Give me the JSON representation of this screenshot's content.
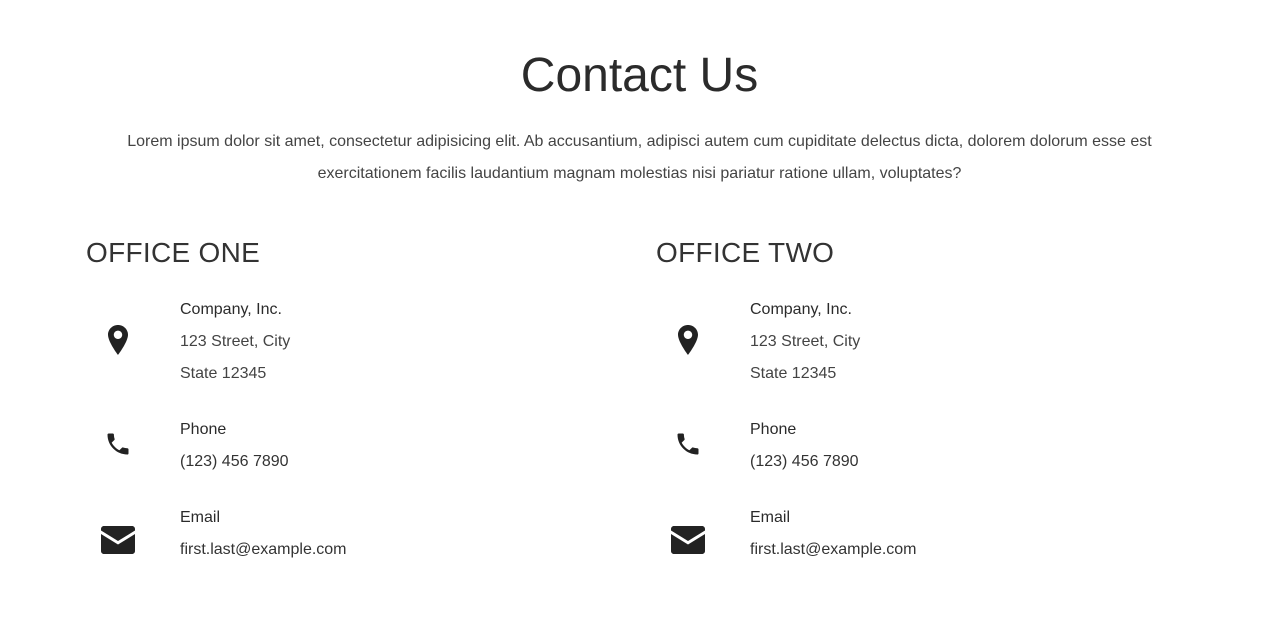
{
  "section": {
    "title": "Contact Us",
    "intro": "Lorem ipsum dolor sit amet, consectetur adipisicing elit. Ab accusantium, adipisci autem cum cupiditate delectus dicta, dolorem dolorum esse est exercitationem facilis laudantium magnam molestias nisi pariatur ratione ullam, voluptates?"
  },
  "offices": [
    {
      "heading": "OFFICE ONE",
      "address": {
        "icon": "map-marker-icon",
        "company": "Company, Inc.",
        "street": "123 Street, City",
        "state": "State 12345"
      },
      "phone": {
        "icon": "phone-icon",
        "label": "Phone",
        "number": "(123) 456 7890"
      },
      "email": {
        "icon": "envelope-icon",
        "label": "Email",
        "address": "first.last@example.com"
      }
    },
    {
      "heading": "OFFICE TWO",
      "address": {
        "icon": "map-marker-icon",
        "company": "Company, Inc.",
        "street": "123 Street, City",
        "state": "State 12345"
      },
      "phone": {
        "icon": "phone-icon",
        "label": "Phone",
        "number": "(123) 456 7890"
      },
      "email": {
        "icon": "envelope-icon",
        "label": "Email",
        "address": "first.last@example.com"
      }
    }
  ],
  "colors": {
    "text": "#2b2b2b",
    "icon": "#222222",
    "background": "#ffffff"
  }
}
